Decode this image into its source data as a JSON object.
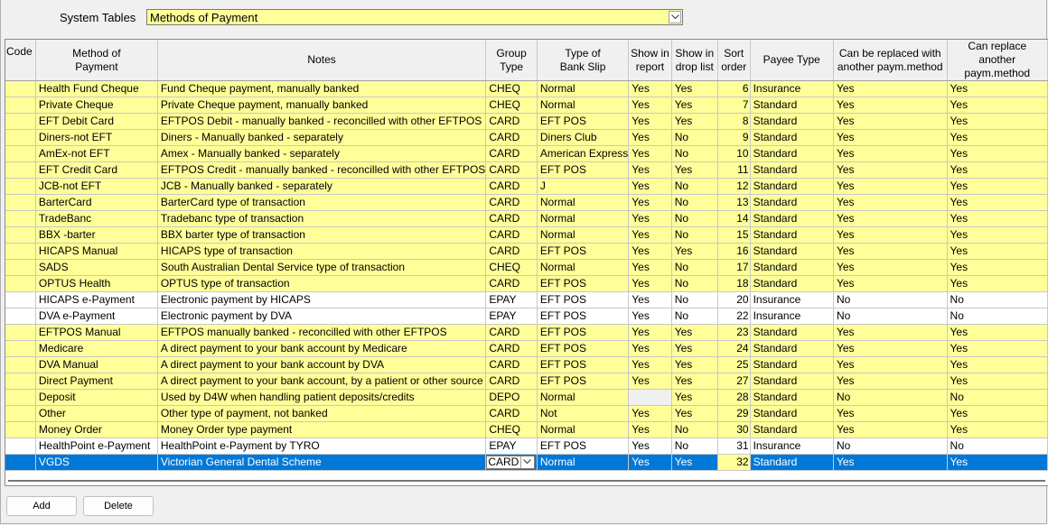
{
  "header": {
    "label": "System Tables",
    "selected_table": "Methods of Payment"
  },
  "columns": [
    "Code",
    "Method of\nPayment",
    "Notes",
    "Group\nType",
    "Type of\nBank Slip",
    "Show in\nreport",
    "Show in\ndrop list",
    "Sort\norder",
    "Payee Type",
    "Can be replaced with\nanother paym.method",
    "Can replace another\npaym.method"
  ],
  "rows": [
    {
      "code": "",
      "method": "Health Fund Cheque",
      "notes": "Fund Cheque payment, manually banked",
      "group": "CHEQ",
      "slip": "Normal",
      "report": "Yes",
      "drop": "Yes",
      "sort": "6",
      "payee": "Insurance",
      "replaced": "Yes",
      "replace": "Yes",
      "style": "y"
    },
    {
      "code": "",
      "method": "Private Cheque",
      "notes": "Private Cheque payment, manually banked",
      "group": "CHEQ",
      "slip": "Normal",
      "report": "Yes",
      "drop": "Yes",
      "sort": "7",
      "payee": "Standard",
      "replaced": "Yes",
      "replace": "Yes",
      "style": "y"
    },
    {
      "code": "",
      "method": "EFT Debit Card",
      "notes": "EFTPOS Debit - manually banked - reconcilled with other EFTPOS",
      "group": "CARD",
      "slip": "EFT POS",
      "report": "Yes",
      "drop": "Yes",
      "sort": "8",
      "payee": "Standard",
      "replaced": "Yes",
      "replace": "Yes",
      "style": "y"
    },
    {
      "code": "",
      "method": "Diners-not EFT",
      "notes": "Diners - Manually banked - separately",
      "group": "CARD",
      "slip": "Diners Club",
      "report": "Yes",
      "drop": "No",
      "sort": "9",
      "payee": "Standard",
      "replaced": "Yes",
      "replace": "Yes",
      "style": "y"
    },
    {
      "code": "",
      "method": "AmEx-not EFT",
      "notes": "Amex - Manually banked - separately",
      "group": "CARD",
      "slip": "American Express",
      "report": "Yes",
      "drop": "No",
      "sort": "10",
      "payee": "Standard",
      "replaced": "Yes",
      "replace": "Yes",
      "style": "y"
    },
    {
      "code": "",
      "method": "EFT Credit Card",
      "notes": "EFTPOS Credit - manually banked - reconcilled with other EFTPOS",
      "group": "CARD",
      "slip": "EFT POS",
      "report": "Yes",
      "drop": "Yes",
      "sort": "11",
      "payee": "Standard",
      "replaced": "Yes",
      "replace": "Yes",
      "style": "y"
    },
    {
      "code": "",
      "method": "JCB-not EFT",
      "notes": "JCB - Manually banked - separately",
      "group": "CARD",
      "slip": "J",
      "report": "Yes",
      "drop": "No",
      "sort": "12",
      "payee": "Standard",
      "replaced": "Yes",
      "replace": "Yes",
      "style": "y"
    },
    {
      "code": "",
      "method": "BarterCard",
      "notes": "BarterCard type of transaction",
      "group": "CARD",
      "slip": "Normal",
      "report": "Yes",
      "drop": "No",
      "sort": "13",
      "payee": "Standard",
      "replaced": "Yes",
      "replace": "Yes",
      "style": "y"
    },
    {
      "code": "",
      "method": "TradeBanc",
      "notes": "Tradebanc type of transaction",
      "group": "CARD",
      "slip": "Normal",
      "report": "Yes",
      "drop": "No",
      "sort": "14",
      "payee": "Standard",
      "replaced": "Yes",
      "replace": "Yes",
      "style": "y"
    },
    {
      "code": "",
      "method": "BBX -barter",
      "notes": "BBX barter type of transaction",
      "group": "CARD",
      "slip": "Normal",
      "report": "Yes",
      "drop": "No",
      "sort": "15",
      "payee": "Standard",
      "replaced": "Yes",
      "replace": "Yes",
      "style": "y"
    },
    {
      "code": "",
      "method": "HICAPS Manual",
      "notes": "HICAPS type of transaction",
      "group": "CARD",
      "slip": "EFT POS",
      "report": "Yes",
      "drop": "Yes",
      "sort": "16",
      "payee": "Standard",
      "replaced": "Yes",
      "replace": "Yes",
      "style": "y"
    },
    {
      "code": "",
      "method": "SADS",
      "notes": "South Australian Dental Service type of transaction",
      "group": "CHEQ",
      "slip": "Normal",
      "report": "Yes",
      "drop": "No",
      "sort": "17",
      "payee": "Standard",
      "replaced": "Yes",
      "replace": "Yes",
      "style": "y"
    },
    {
      "code": "",
      "method": "OPTUS Health",
      "notes": "OPTUS type of transaction",
      "group": "CARD",
      "slip": "EFT POS",
      "report": "Yes",
      "drop": "No",
      "sort": "18",
      "payee": "Standard",
      "replaced": "Yes",
      "replace": "Yes",
      "style": "y"
    },
    {
      "code": "",
      "method": "HICAPS e-Payment",
      "notes": "Electronic payment by HICAPS",
      "group": "EPAY",
      "slip": "EFT POS",
      "report": "Yes",
      "drop": "No",
      "sort": "20",
      "payee": "Insurance",
      "replaced": "No",
      "replace": "No",
      "style": "w"
    },
    {
      "code": "",
      "method": "DVA e-Payment",
      "notes": "Electronic payment by DVA",
      "group": "EPAY",
      "slip": "EFT POS",
      "report": "Yes",
      "drop": "No",
      "sort": "22",
      "payee": "Insurance",
      "replaced": "No",
      "replace": "No",
      "style": "w"
    },
    {
      "code": "",
      "method": "EFTPOS Manual",
      "notes": "EFTPOS manually banked - reconcilled with other EFTPOS",
      "group": "CARD",
      "slip": "EFT POS",
      "report": "Yes",
      "drop": "Yes",
      "sort": "23",
      "payee": "Standard",
      "replaced": "Yes",
      "replace": "Yes",
      "style": "y"
    },
    {
      "code": "",
      "method": "Medicare",
      "notes": "A direct payment to your bank account by Medicare",
      "group": "CARD",
      "slip": "EFT POS",
      "report": "Yes",
      "drop": "Yes",
      "sort": "24",
      "payee": "Standard",
      "replaced": "Yes",
      "replace": "Yes",
      "style": "y"
    },
    {
      "code": "",
      "method": "DVA Manual",
      "notes": "A direct payment to your bank account by DVA",
      "group": "CARD",
      "slip": "EFT POS",
      "report": "Yes",
      "drop": "Yes",
      "sort": "25",
      "payee": "Standard",
      "replaced": "Yes",
      "replace": "Yes",
      "style": "y"
    },
    {
      "code": "",
      "method": "Direct Payment",
      "notes": "A direct payment to your bank account, by a patient or other source",
      "group": "CARD",
      "slip": "EFT POS",
      "report": "Yes",
      "drop": "Yes",
      "sort": "27",
      "payee": "Standard",
      "replaced": "Yes",
      "replace": "Yes",
      "style": "y"
    },
    {
      "code": "",
      "method": "Deposit",
      "notes": "Used by D4W when handling patient deposits/credits",
      "group": "DEPO",
      "slip": "Normal",
      "report": "",
      "drop": "Yes",
      "sort": "28",
      "payee": "Standard",
      "replaced": "No",
      "replace": "No",
      "style": "y",
      "report_gray": true
    },
    {
      "code": "",
      "method": "Other",
      "notes": "Other type of payment, not banked",
      "group": "CARD",
      "slip": "Not",
      "report": "Yes",
      "drop": "Yes",
      "sort": "29",
      "payee": "Standard",
      "replaced": "Yes",
      "replace": "Yes",
      "style": "y"
    },
    {
      "code": "",
      "method": "Money Order",
      "notes": "Money Order type payment",
      "group": "CHEQ",
      "slip": "Normal",
      "report": "Yes",
      "drop": "No",
      "sort": "30",
      "payee": "Standard",
      "replaced": "Yes",
      "replace": "Yes",
      "style": "y"
    },
    {
      "code": "",
      "method": "HealthPoint e-Payment",
      "notes": "HealthPoint e-Payment by TYRO",
      "group": "EPAY",
      "slip": "EFT POS",
      "report": "Yes",
      "drop": "No",
      "sort": "31",
      "payee": "Insurance",
      "replaced": "No",
      "replace": "No",
      "style": "w"
    },
    {
      "code": "",
      "method": "VGDS",
      "notes": "Victorian General Dental Scheme",
      "group": "CARD",
      "slip": "Normal",
      "report": "Yes",
      "drop": "Yes",
      "sort": "32",
      "payee": "Standard",
      "replaced": "Yes",
      "replace": "Yes",
      "style": "sel"
    }
  ],
  "buttons": {
    "add": "Add",
    "delete": "Delete"
  }
}
